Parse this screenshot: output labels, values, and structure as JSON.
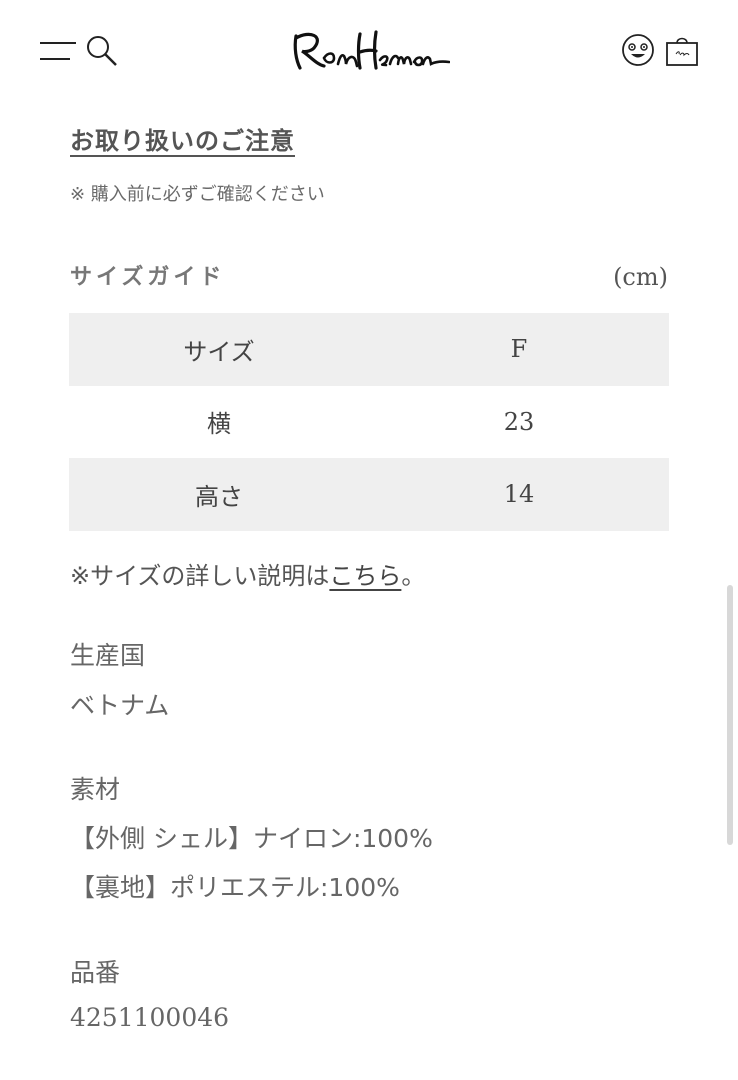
{
  "header": {
    "logo_text": "RonHerman",
    "icons": [
      "menu-icon",
      "search-icon",
      "face-icon",
      "bag-icon"
    ]
  },
  "care": {
    "title": "お取り扱いのご注意",
    "note": "※ 購入前に必ずご確認ください"
  },
  "size_guide": {
    "title": "サイズガイド",
    "unit": "(cm)",
    "rows": [
      {
        "label": "サイズ",
        "value": "F"
      },
      {
        "label": "横",
        "value": "23"
      },
      {
        "label": "高さ",
        "value": "14"
      }
    ],
    "link_prefix": "※サイズの詳しい説明は",
    "link_text": "こちら",
    "link_suffix": "。"
  },
  "specs": {
    "country_label": "生産国",
    "country_value": "ベトナム",
    "material_label": "素材",
    "material_lines": [
      "【外側 シェル】ナイロン:100%",
      "【裏地】ポリエステル:100%"
    ],
    "item_no_label": "品番",
    "item_no_value": "4251100046"
  },
  "colors": {
    "row_shade": "#efefef",
    "text": "#5a5a5a"
  }
}
